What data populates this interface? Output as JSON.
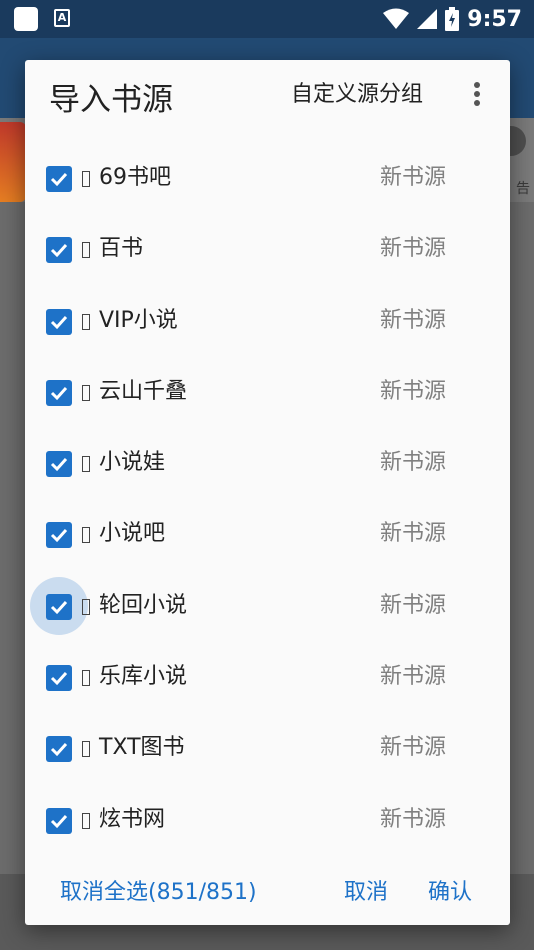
{
  "status_bar": {
    "time": "9:57",
    "icons": [
      "square-icon",
      "a-badge-icon",
      "wifi-icon",
      "signal-icon",
      "battery-charging-icon"
    ],
    "a_badge": "A"
  },
  "dialog": {
    "title": "导入书源",
    "group_button": "自定义源分组",
    "more_icon": "more-vert-icon",
    "items": [
      {
        "name": "69书吧",
        "tag": "新书源",
        "checked": true
      },
      {
        "name": "百书",
        "tag": "新书源",
        "checked": true
      },
      {
        "name": "VIP小说",
        "tag": "新书源",
        "checked": true
      },
      {
        "name": "云山千叠",
        "tag": "新书源",
        "checked": true
      },
      {
        "name": "小说娃",
        "tag": "新书源",
        "checked": true
      },
      {
        "name": "小说吧",
        "tag": "新书源",
        "checked": true
      },
      {
        "name": "轮回小说",
        "tag": "新书源",
        "checked": true
      },
      {
        "name": "乐库小说",
        "tag": "新书源",
        "checked": true
      },
      {
        "name": "TXT图书",
        "tag": "新书源",
        "checked": true
      },
      {
        "name": "炫书网",
        "tag": "新书源",
        "checked": true
      }
    ],
    "footer": {
      "deselect_all": "取消全选(851/851)",
      "cancel": "取消",
      "confirm": "确认"
    }
  },
  "background": {
    "partial_text": "告"
  },
  "colors": {
    "accent": "#1e72c8",
    "status_bar": "#1a3a5d",
    "scrim": "#6c6c6c"
  }
}
